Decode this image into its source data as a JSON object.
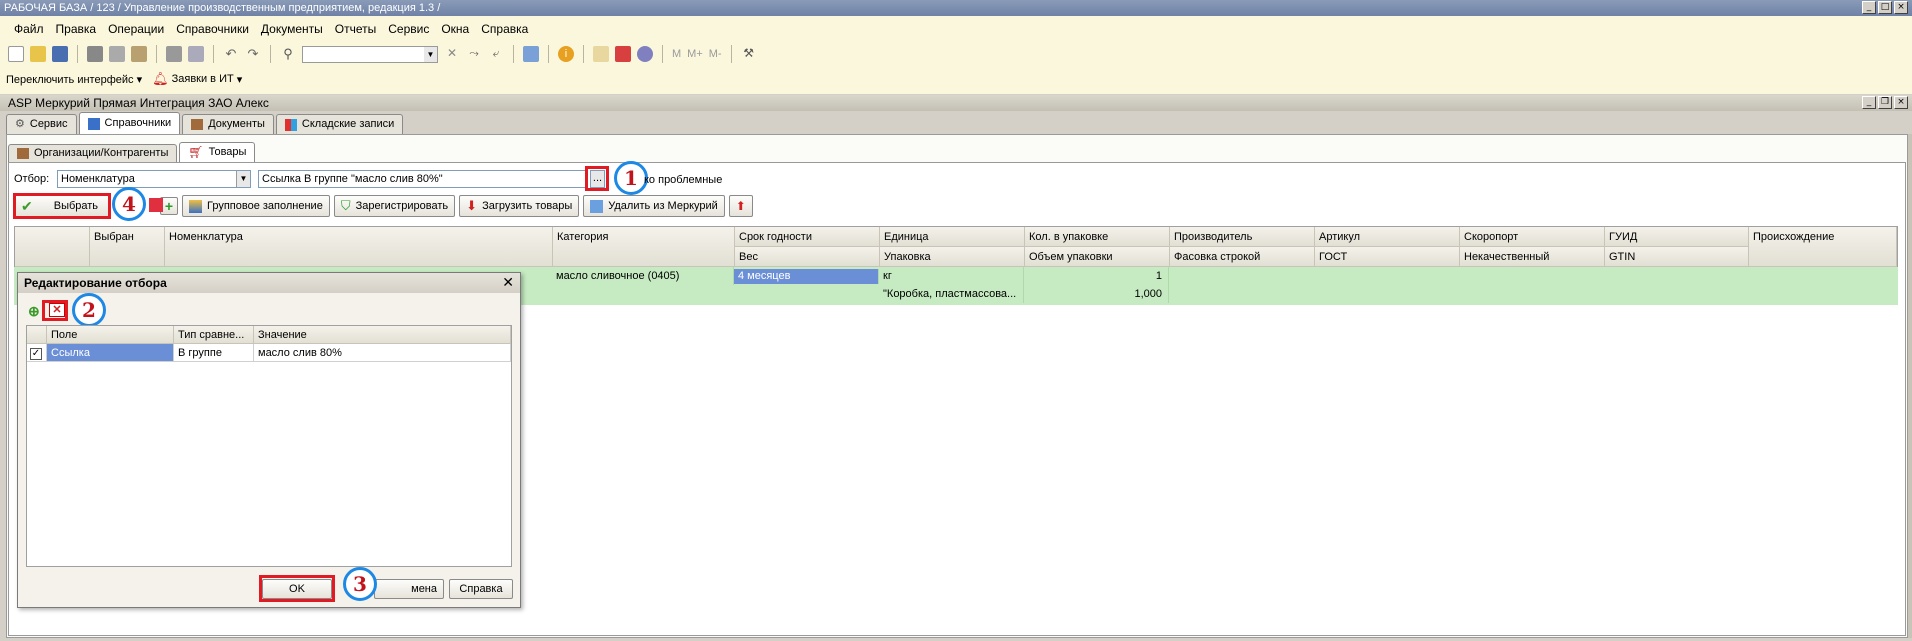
{
  "window": {
    "title": "РАБОЧАЯ БАЗА / 123 /  Управление производственным предприятием, редакция 1.3 /",
    "doc_title": "ASP Меркурий Прямая Интеграция ЗАО Алекс"
  },
  "menu": [
    "Файл",
    "Правка",
    "Операции",
    "Справочники",
    "Документы",
    "Отчеты",
    "Сервис",
    "Окна",
    "Справка"
  ],
  "toolbar2": {
    "switch_interface": "Переключить интерфейс",
    "it_requests": "Заявки в ИТ"
  },
  "main_tabs": [
    "Сервис",
    "Справочники",
    "Документы",
    "Складские записи"
  ],
  "sub_tabs": [
    "Организации/Контрагенты",
    "Товары"
  ],
  "filter": {
    "label": "Отбор:",
    "field": "Номенклатура",
    "value": "Ссылка В группе \"масло слив 80%\"",
    "ellipsis": "...",
    "problem_only": "ко проблемные"
  },
  "actions": {
    "select": "Выбрать",
    "group_fill": "Групповое заполнение",
    "register": "Зарегистрировать",
    "load_goods": "Загрузить товары",
    "delete_mercury": "Удалить из Меркурий"
  },
  "grid": {
    "headers_top": [
      "",
      "Выбран",
      "Номенклатура",
      "Категория",
      "Срок годности",
      "Единица",
      "Кол. в упаковке",
      "Производитель",
      "Артикул",
      "Скоропорт",
      "ГУИД",
      "Происхождение"
    ],
    "headers_bottom": [
      "Вес",
      "Упаковка",
      "Объем упаковки",
      "Фасовка строкой",
      "ГОСТ",
      "Некачественный",
      "GTIN"
    ],
    "row": {
      "category": "масло сливочное (0405)",
      "shelf_life": "4 месяцев",
      "unit": "кг",
      "pack_qty": "1",
      "packaging": "\"Коробка, пластмассова...",
      "pack_volume": "1,000"
    }
  },
  "dialog": {
    "title": "Редактирование отбора",
    "headers": [
      "Поле",
      "Тип сравне...",
      "Значение"
    ],
    "row": {
      "field": "Ссылка",
      "compare": "В группе",
      "value": "масло слив 80%"
    },
    "ok": "OK",
    "cancel": "мена",
    "help": "Справка"
  },
  "callouts": [
    "1",
    "2",
    "3",
    "4"
  ],
  "colors": {
    "accent_red": "#e01b24",
    "callout_blue": "#1e88e5",
    "row_green": "#c6ebc2",
    "selected_blue": "#6b8fd6"
  }
}
